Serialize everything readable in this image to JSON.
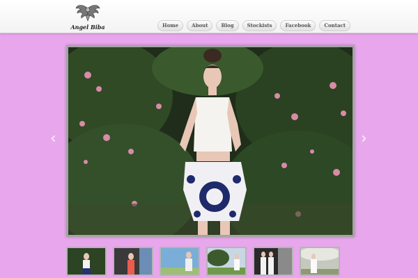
{
  "header": {
    "logo_text": "Angel Biba"
  },
  "nav": {
    "items": [
      {
        "label": "Home"
      },
      {
        "label": "About"
      },
      {
        "label": "Blog"
      },
      {
        "label": "Stockists"
      },
      {
        "label": "Facebook"
      },
      {
        "label": "Contact"
      }
    ]
  },
  "slider": {
    "prev_icon": "chevron-left-icon",
    "next_icon": "chevron-right-icon",
    "thumbnail_count": 6
  },
  "colors": {
    "page_background": "#e8a6ec",
    "header_background": "#ffffff",
    "nav_text": "#555555"
  }
}
